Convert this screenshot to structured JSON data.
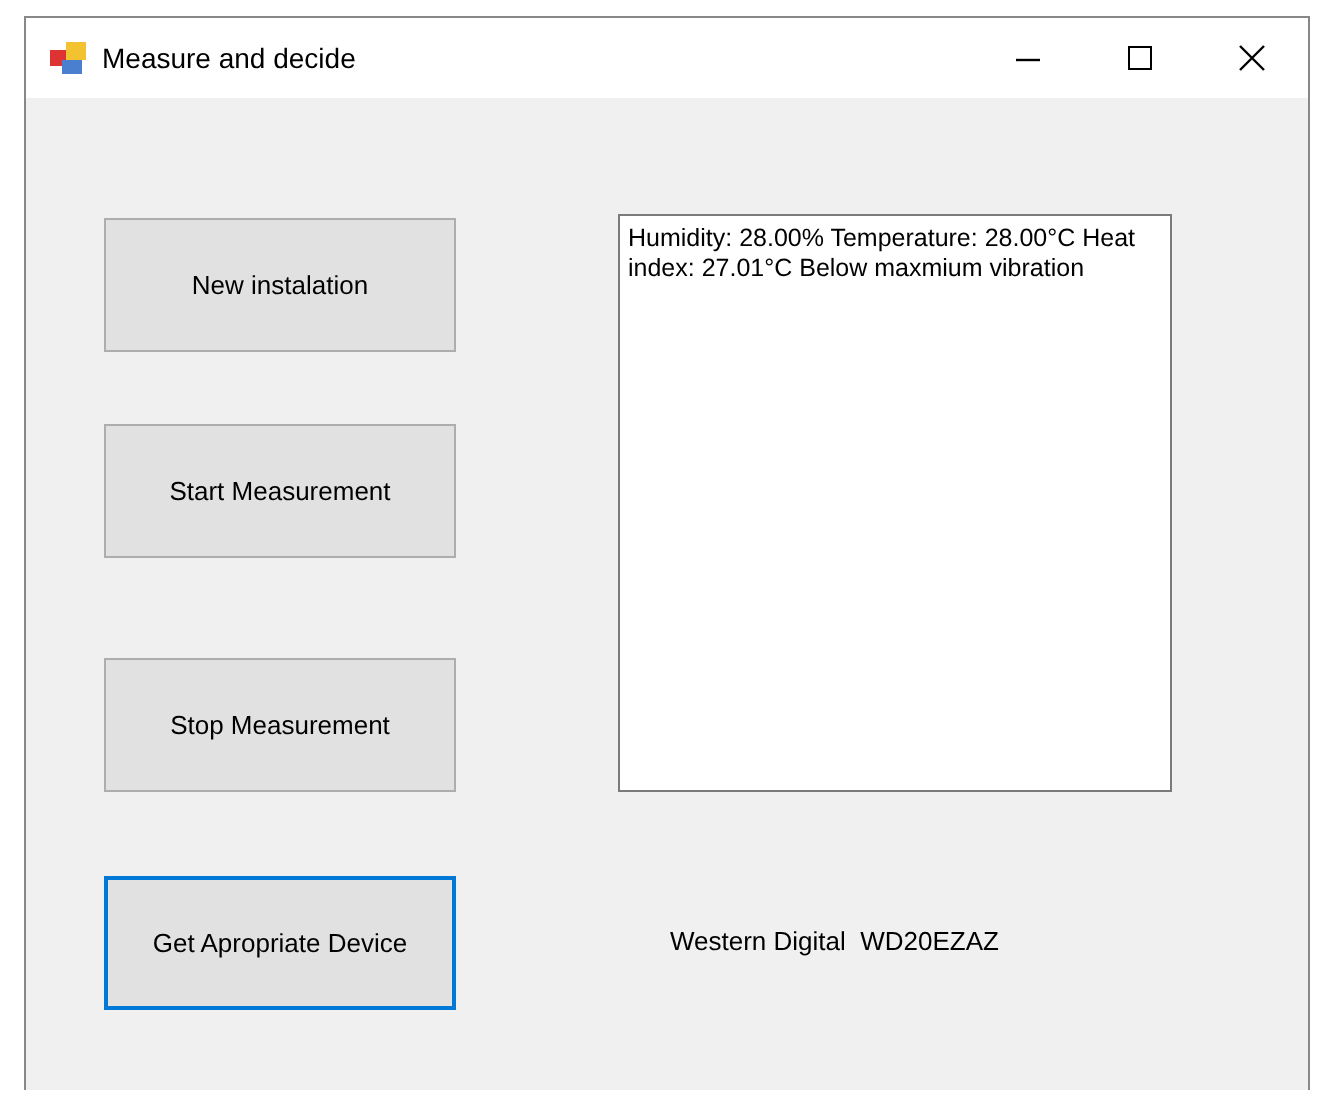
{
  "window": {
    "title": "Measure and decide"
  },
  "buttons": [
    {
      "label": "New instalation",
      "focused": false
    },
    {
      "label": "Start Measurement",
      "focused": false
    },
    {
      "label": "Stop Measurement",
      "focused": false
    },
    {
      "label": "Get Apropriate Device",
      "focused": true
    }
  ],
  "output_box": {
    "value": "Humidity: 28.00%  Temperature: 28.00°C Heat index: 27.01°C  Below maxmium vibration"
  },
  "result_label": "Western Digital  WD20EZAZ"
}
